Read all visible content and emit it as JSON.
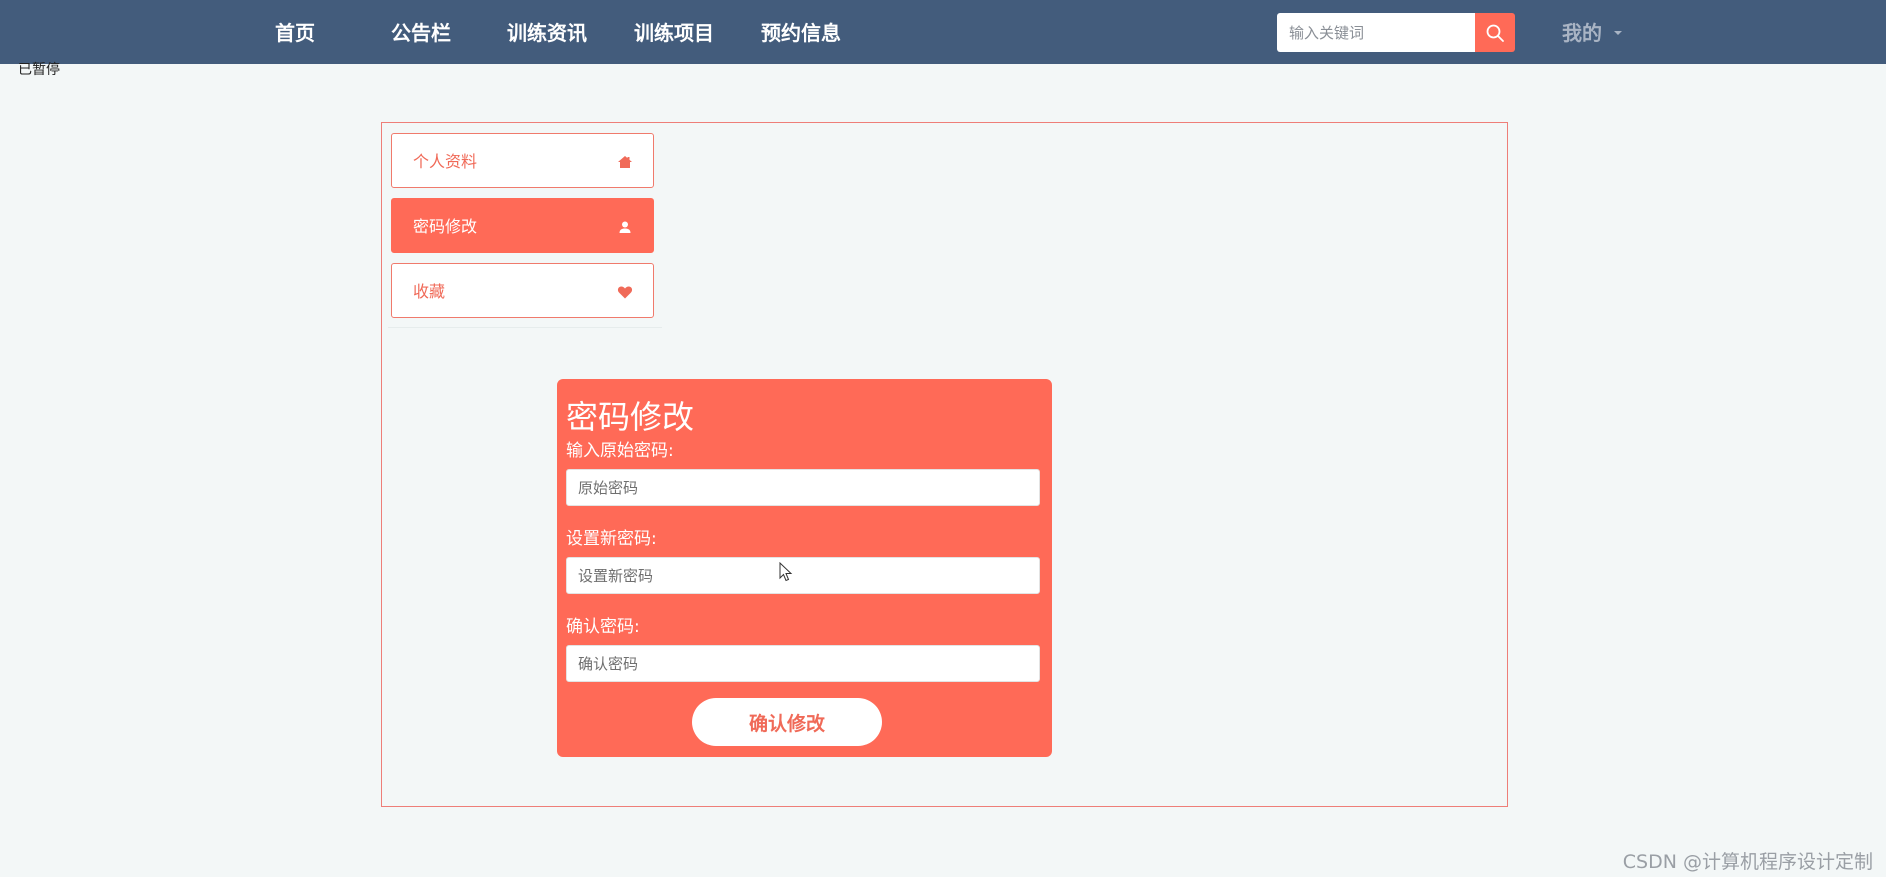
{
  "nav": {
    "items": [
      "首页",
      "公告栏",
      "训练资讯",
      "训练项目",
      "预约信息"
    ],
    "search_placeholder": "输入关键词",
    "user_menu_label": "我的"
  },
  "status": {
    "paused_label": "已暂停"
  },
  "sidebar": {
    "items": [
      {
        "label": "个人资料",
        "icon": "home-icon",
        "active": false
      },
      {
        "label": "密码修改",
        "icon": "user-icon",
        "active": true
      },
      {
        "label": "收藏",
        "icon": "heart-icon",
        "active": false
      }
    ]
  },
  "form": {
    "title": "密码修改",
    "fields": [
      {
        "label": "输入原始密码:",
        "placeholder": "原始密码"
      },
      {
        "label": "设置新密码:",
        "placeholder": "设置新密码"
      },
      {
        "label": "确认密码:",
        "placeholder": "确认密码"
      }
    ],
    "submit_label": "确认修改"
  },
  "watermark": "CSDN @计算机程序设计定制",
  "colors": {
    "topbar": "#435c7c",
    "accent": "#ff6a57",
    "border": "#ee7e78",
    "background": "#f3f7f7"
  }
}
